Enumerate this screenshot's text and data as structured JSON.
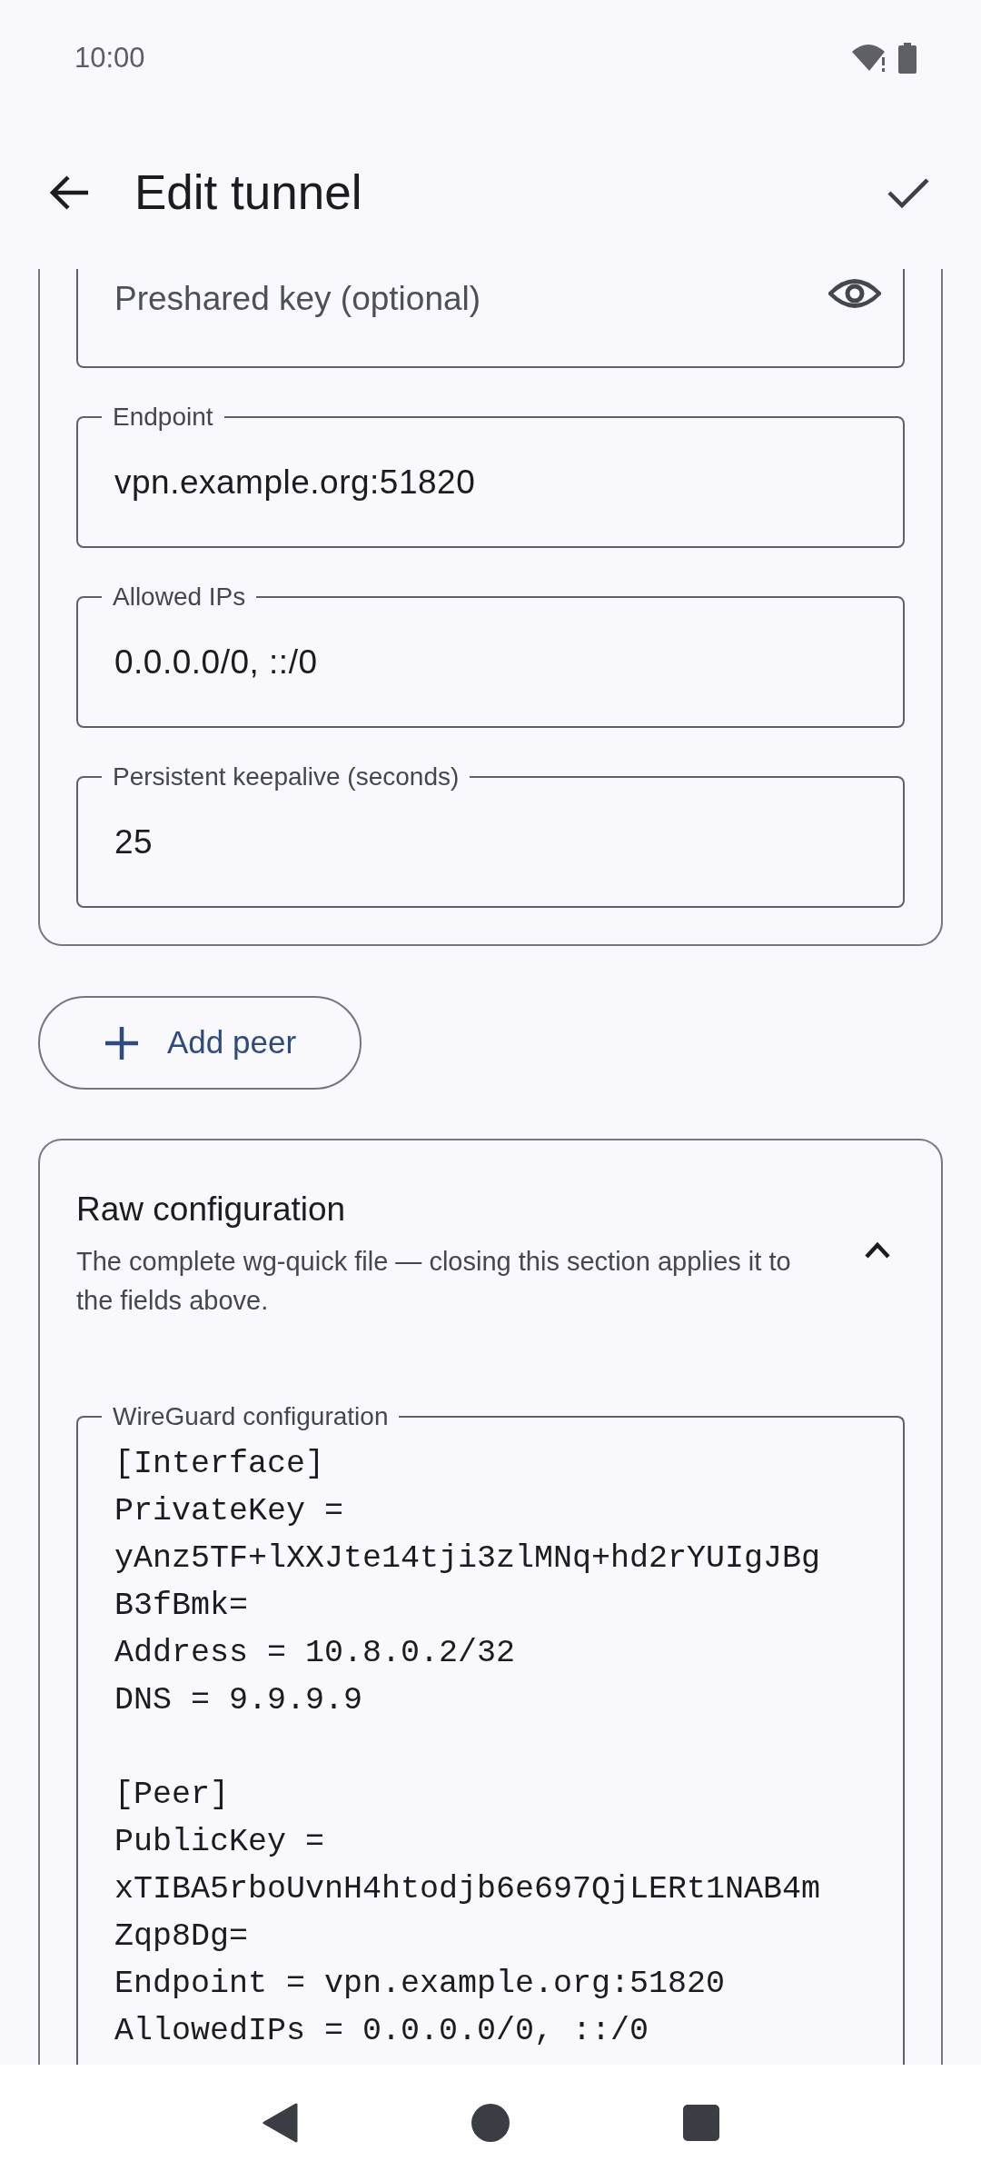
{
  "status_bar": {
    "time": "10:00"
  },
  "app_bar": {
    "title": "Edit tunnel"
  },
  "peer": {
    "fields": [
      {
        "kind": "secret",
        "placeholder": "Preshared key (optional)"
      },
      {
        "kind": "text",
        "label": "Endpoint",
        "value": "vpn.example.org:51820"
      },
      {
        "kind": "text",
        "label": "Allowed IPs",
        "value": "0.0.0.0/0, ::/0"
      },
      {
        "kind": "text",
        "label": "Persistent keepalive (seconds)",
        "value": "25"
      }
    ]
  },
  "add_peer_button": "Add peer",
  "raw_section": {
    "title": "Raw configuration",
    "subtitle": "The complete wg-quick file — closing this section applies it to the fields above.",
    "expanded": true,
    "field": {
      "label": "WireGuard configuration",
      "value": "[Interface]\nPrivateKey = yAnz5TF+lXXJte14tji3zlMNq+hd2rYUIgJBgB3fBmk=\nAddress = 10.8.0.2/32\nDNS = 9.9.9.9\n\n[Peer]\nPublicKey = xTIBA5rboUvnH4htodjb6e697QjLERt1NAB4mZqp8Dg=\nEndpoint = vpn.example.org:51820\nAllowedIPs = 0.0.0.0/0, ::/0"
    }
  }
}
